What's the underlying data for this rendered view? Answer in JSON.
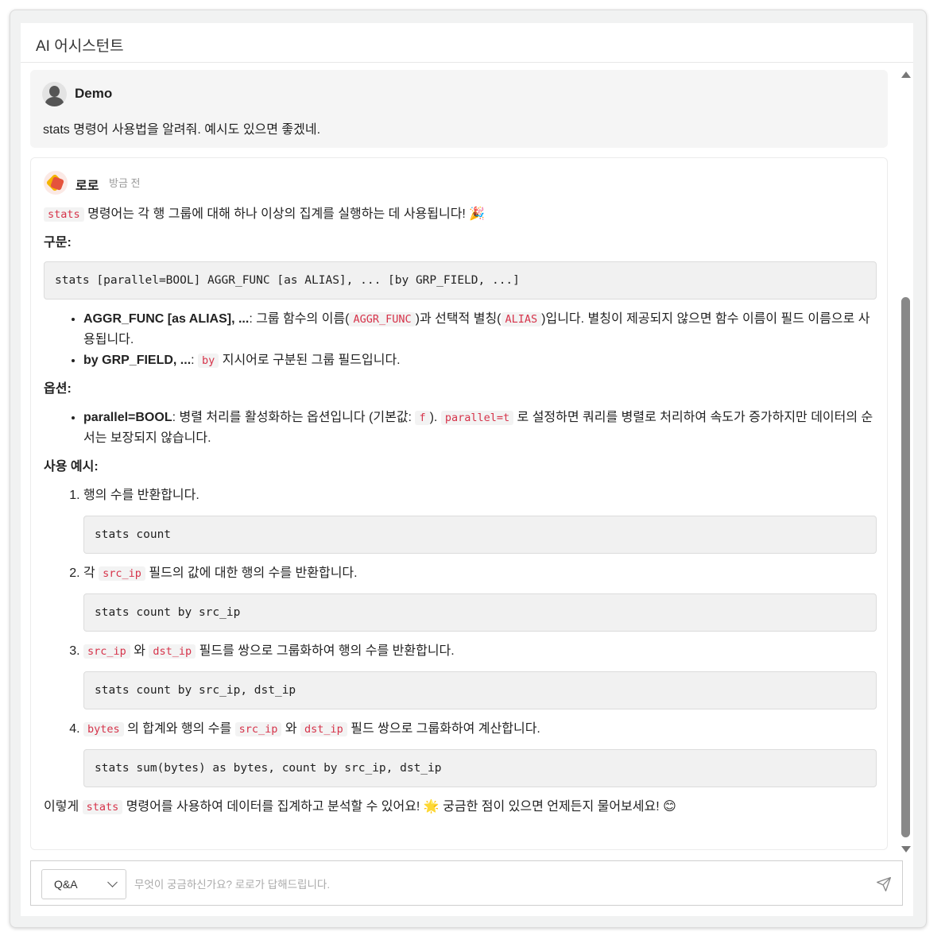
{
  "window": {
    "title": "AI 어시스턴트"
  },
  "user_message": {
    "name": "Demo",
    "text": "stats 명령어 사용법을 알려줘. 예시도 있으면 좋겠네."
  },
  "bot_message": {
    "name": "로로",
    "time": "방금 전",
    "intro": {
      "code": "stats",
      "text": "명령어는 각 행 그룹에 대해 하나 이상의 집계를 실행하는 데 사용됩니다! 🎉"
    },
    "syntax_heading": "구문:",
    "syntax_code": "stats [parallel=BOOL] AGGR_FUNC [as ALIAS], ... [by GRP_FIELD, ...]",
    "syntax_items": [
      {
        "bold": "AGGR_FUNC [as ALIAS], ...",
        "t1": ": 그룹 함수의 이름(",
        "c1": "AGGR_FUNC",
        "t2": ")과 선택적 별칭(",
        "c2": "ALIAS",
        "t3": ")입니다. 별칭이 제공되지 않으면 함수 이름이 필드 이름으로 사용됩니다."
      },
      {
        "bold": "by GRP_FIELD, ...",
        "t1": ": ",
        "c1": "by",
        "t2": " 지시어로 구분된 그룹 필드입니다."
      }
    ],
    "options_heading": "옵션:",
    "options_items": [
      {
        "bold": "parallel=BOOL",
        "t1": ": 병렬 처리를 활성화하는 옵션입니다 (기본값: ",
        "c1": "f",
        "t2": "). ",
        "c2": "parallel=t",
        "t3": " 로 설정하면 쿼리를 병렬로 처리하여 속도가 증가하지만 데이터의 순서는 보장되지 않습니다."
      }
    ],
    "examples_heading": "사용 예시:",
    "examples": [
      {
        "parts": [
          "행의 수를 반환합니다."
        ],
        "codes": [],
        "code": "stats count"
      },
      {
        "parts": [
          "각 ",
          " 필드의 값에 대한 행의 수를 반환합니다."
        ],
        "codes": [
          "src_ip"
        ],
        "code": "stats count by src_ip"
      },
      {
        "parts": [
          "",
          " 와 ",
          " 필드를 쌍으로 그룹화하여 행의 수를 반환합니다."
        ],
        "codes": [
          "src_ip",
          "dst_ip"
        ],
        "code": "stats count by src_ip, dst_ip"
      },
      {
        "parts": [
          "",
          " 의 합계와 행의 수를 ",
          " 와 ",
          " 필드 쌍으로 그룹화하여 계산합니다."
        ],
        "codes": [
          "bytes",
          "src_ip",
          "dst_ip"
        ],
        "code": "stats sum(bytes) as bytes, count by src_ip, dst_ip"
      }
    ],
    "outro": {
      "t1": "이렇게 ",
      "code": "stats",
      "t2": " 명령어를 사용하여 데이터를 집계하고 분석할 수 있어요! 🌟 궁금한 점이 있으면 언제든지 물어보세요! 😊"
    }
  },
  "composer": {
    "mode": "Q&A",
    "placeholder": "무엇이 궁금하신가요? 로로가 답해드립니다."
  }
}
